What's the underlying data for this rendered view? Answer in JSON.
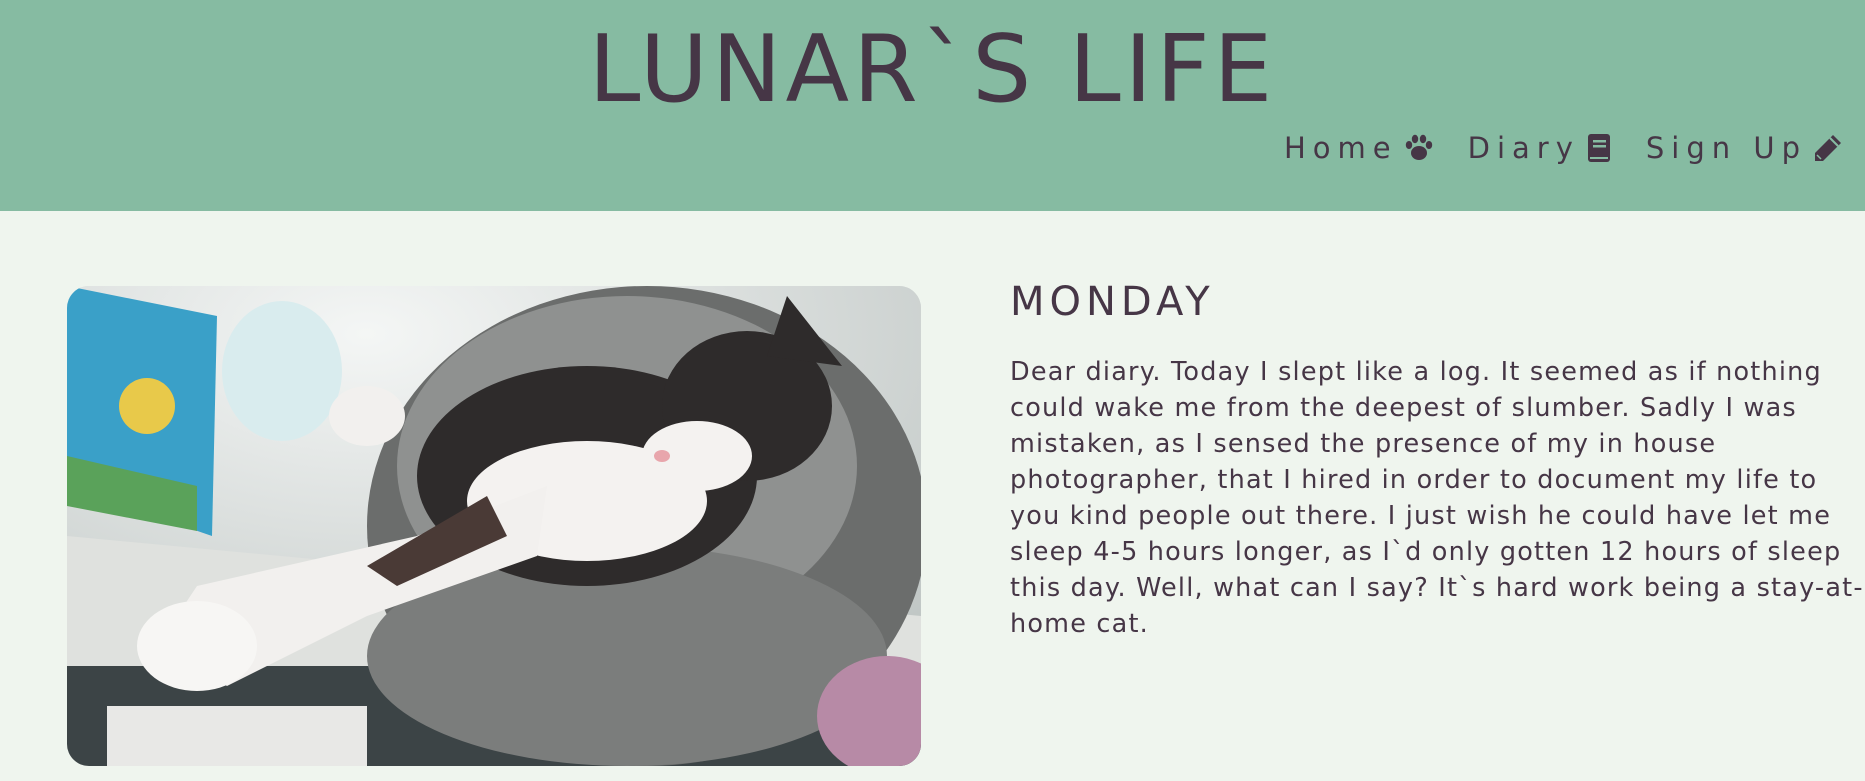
{
  "site": {
    "title": "LUNAR`S LIFE"
  },
  "nav": {
    "items": [
      {
        "label": "Home",
        "icon": "paw-icon"
      },
      {
        "label": "Diary",
        "icon": "book-icon"
      },
      {
        "label": "Sign Up",
        "icon": "pencil-icon"
      }
    ]
  },
  "entry": {
    "heading": "MONDAY",
    "body": "Dear diary. Today I slept like a log. It seemed as if nothing could wake me from the deepest of slumber. Sadly I was mistaken, as I sensed the presence of my in house photographer, that I hired in order to document my life to you kind people out there. I just wish he could have let me sleep 4-5 hours longer, as I`d only gotten 12 hours of sleep this day. Well, what can I say? It`s hard work being a stay-at-home cat.",
    "photo_alt": "sleeping cat photo"
  },
  "colors": {
    "header_bg": "#86bba2",
    "page_bg": "#eff5ee",
    "text": "#463646"
  }
}
